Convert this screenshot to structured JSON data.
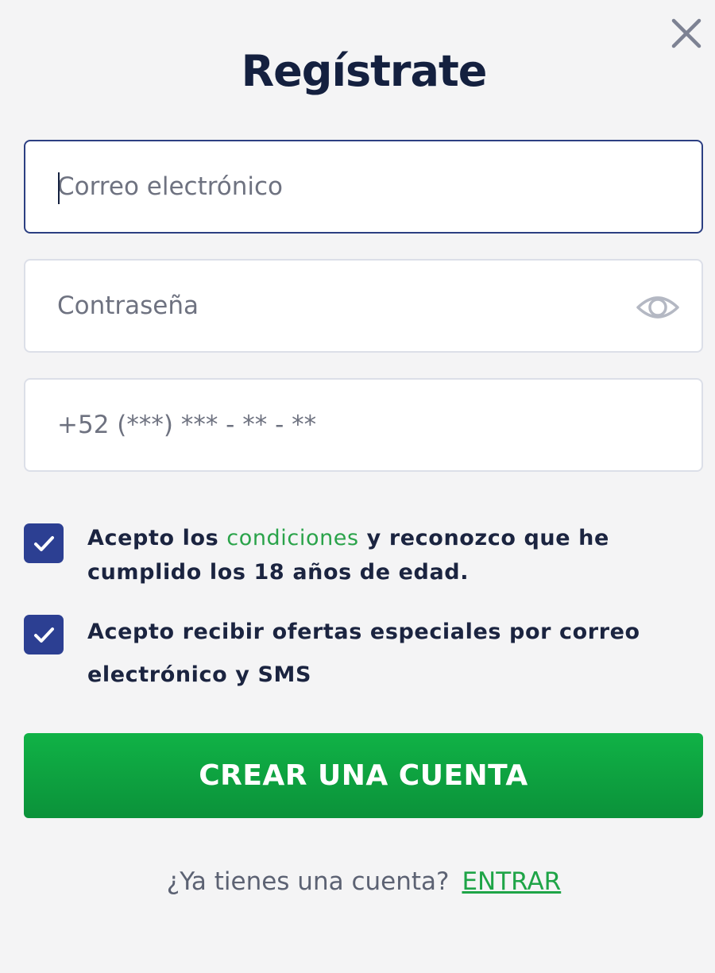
{
  "dialog": {
    "title": "Regístrate",
    "close_icon": "close-icon"
  },
  "form": {
    "email": {
      "placeholder": "Correo electrónico",
      "value": ""
    },
    "password": {
      "placeholder": "Contraseña",
      "value": "",
      "toggle_icon": "eye-icon"
    },
    "phone": {
      "placeholder": "+52 (***) *** - ** - **",
      "value": ""
    }
  },
  "consents": [
    {
      "checked": true,
      "text_before": "Acepto los ",
      "link": "condiciones",
      "text_after": " y reconozco que he cumplido los 18 años de edad."
    },
    {
      "checked": true,
      "text": "Acepto recibir ofertas especiales por correo electrónico y SMS"
    }
  ],
  "submit": {
    "label": "CREAR UNA CUENTA"
  },
  "footer": {
    "prompt": "¿Ya tienes una cuenta?",
    "login_label": "ENTRAR"
  },
  "colors": {
    "title": "#14203f",
    "accent_green": "#10b246",
    "checkbox": "#2c3f92",
    "focus_border": "#2c3f82",
    "link_green": "#2aa34a"
  }
}
